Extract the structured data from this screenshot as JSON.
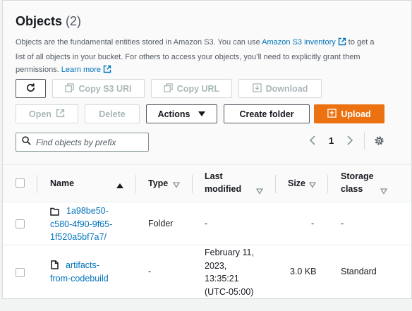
{
  "header": {
    "title": "Objects",
    "count": "(2)",
    "description": {
      "part1": "Objects are the fundamental entities stored in Amazon S3. You can use ",
      "link_inventory": "Amazon S3 inventory",
      "part2": " to get a list of all objects in your bucket. For others to access your objects, you’ll need to explicitly grant them permissions. ",
      "link_learn_more": "Learn more"
    }
  },
  "toolbar": {
    "copy_s3_uri": "Copy S3 URI",
    "copy_url": "Copy URL",
    "download": "Download",
    "open": "Open",
    "delete": "Delete",
    "actions": "Actions",
    "create_folder": "Create folder",
    "upload": "Upload"
  },
  "search": {
    "placeholder": "Find objects by prefix",
    "value": ""
  },
  "pagination": {
    "page": "1"
  },
  "table": {
    "columns": {
      "name": "Name",
      "type": "Type",
      "last_modified": [
        "Last",
        "modified"
      ],
      "size": "Size",
      "storage_class": [
        "Storage",
        "class"
      ]
    },
    "rows": [
      {
        "icon": "folder-icon",
        "name_lines": [
          "1a98be50-",
          "c580-4f90-9f65-",
          "1f520a5bf7a7/"
        ],
        "type": "Folder",
        "last_modified": "-",
        "size": "-",
        "storage_class": "-"
      },
      {
        "icon": "file-icon",
        "name_lines": [
          "artifacts-",
          "from-codebuild"
        ],
        "type": "-",
        "last_modified_lines": [
          "February 11,",
          "2023,",
          "13:35:21",
          "(UTC-05:00)"
        ],
        "size": "3.0 KB",
        "storage_class": "Standard"
      }
    ]
  },
  "colors": {
    "accent": "#ec7211",
    "link": "#0073bb",
    "border": "#d5dbdb"
  }
}
